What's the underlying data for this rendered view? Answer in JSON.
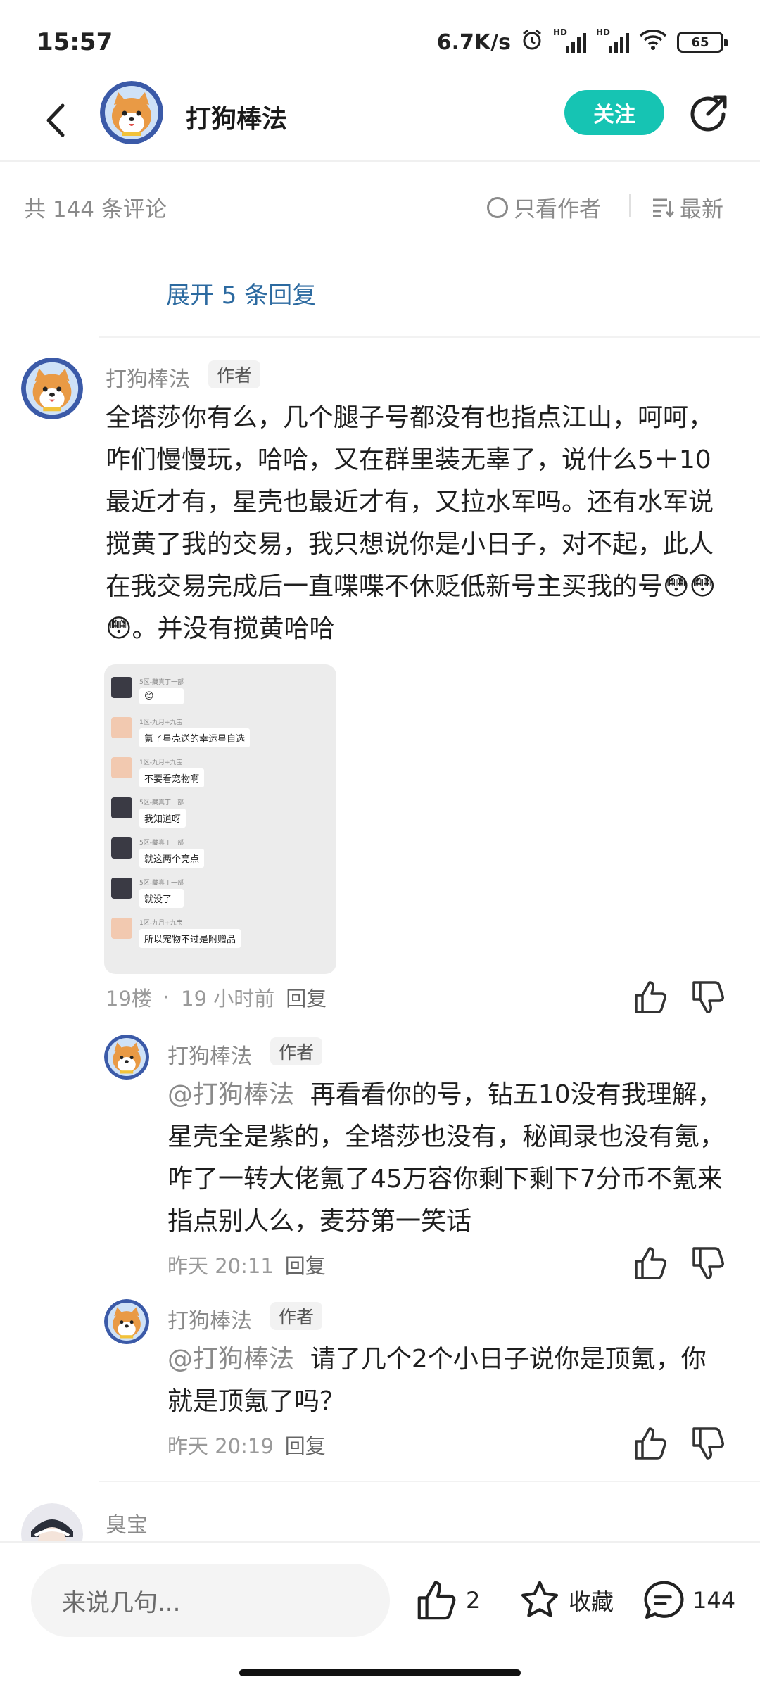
{
  "status_bar": {
    "time": "15:57",
    "network_speed": "6.7K/s",
    "signal1_label": "HD",
    "signal2_label": "HD",
    "battery": "65"
  },
  "header": {
    "title": "打狗棒法",
    "follow_label": "关注"
  },
  "filter_bar": {
    "comment_count": "共 144 条评论",
    "only_author": "只看作者",
    "sort_label": "最新"
  },
  "expand_replies": "展开 5 条回复",
  "main_comment": {
    "username": "打狗棒法",
    "tag": "作者",
    "text": "全塔莎你有么，几个腿子号都没有也指点江山，呵呵，咋们慢慢玩，哈哈，又在群里装无辜了，说什么5＋10最近才有，星壳也最近才有，又拉水军吗。还有水军说搅黄了我的交易，我只想说你是小日子，对不起，此人在我交易完成后一直喋喋不休贬低新号主买我的号😳😳😳。并没有搅黄哈哈",
    "floor": "19楼",
    "dot": "·",
    "time": "19 小时前",
    "reply_label": "回复",
    "image_chat": [
      {
        "name": "5区-藏真丁一部",
        "msg": "😊"
      },
      {
        "name": "1区-九月+九宝",
        "msg": "氪了星壳送的幸运星自选"
      },
      {
        "name": "1区-九月+九宝",
        "msg": "不要看宠物啊"
      },
      {
        "name": "5区-藏真丁一部",
        "msg": "我知道呀"
      },
      {
        "name": "5区-藏真丁一部",
        "msg": "就这两个亮点"
      },
      {
        "name": "5区-藏真丁一部",
        "msg": "就没了"
      },
      {
        "name": "1区-九月+九宝",
        "msg": "所以宠物不过是附赠品"
      }
    ]
  },
  "replies": [
    {
      "username": "打狗棒法",
      "tag": "作者",
      "mention": "@打狗棒法",
      "text": "再看看你的号，钻五10没有我理解，星壳全是紫的，全塔莎也没有，秘闻录也没有氪，咋了一转大佬氪了45万容你剩下剩下7分币不氪来指点别人么，麦芬第一笑话",
      "time": "昨天 20:11",
      "reply_label": "回复"
    },
    {
      "username": "打狗棒法",
      "tag": "作者",
      "mention": "@打狗棒法",
      "text": "请了几个2个小日子说你是顶氪，你就是顶氪了吗？",
      "time": "昨天 20:19",
      "reply_label": "回复"
    }
  ],
  "next_comment": {
    "username": "臭宝"
  },
  "bottom_bar": {
    "input_placeholder": "来说几句...",
    "like_count": "2",
    "favorite_label": "收藏",
    "comment_count": "144"
  }
}
